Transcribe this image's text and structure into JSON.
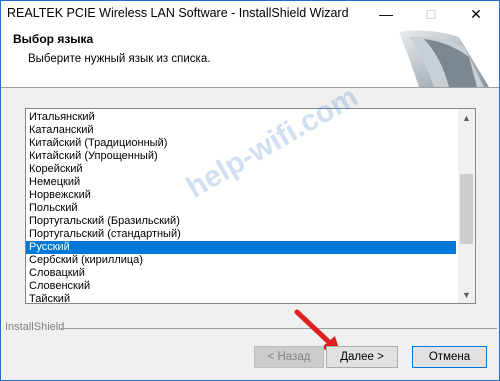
{
  "window": {
    "title": "REALTEK PCIE Wireless LAN Software - InstallShield Wizard"
  },
  "header": {
    "title": "Выбор языка",
    "subtitle": "Выберите нужный язык из списка."
  },
  "languages": [
    "Итальянский",
    "Каталанский",
    "Китайский (Традиционный)",
    "Китайский (Упрощенный)",
    "Корейский",
    "Немецкий",
    "Норвежский",
    "Польский",
    "Португальский (Бразильский)",
    "Португальский (стандартный)",
    "Русский",
    "Сербский (кириллица)",
    "Словацкий",
    "Словенский",
    "Тайский"
  ],
  "selected_language": "Русский",
  "footer": {
    "brand": "InstallShield",
    "back_label": "< Назад",
    "next_label": "Далее >",
    "cancel_label": "Отмена"
  },
  "watermark": "help-wifi.com",
  "colors": {
    "selection": "#0078d7",
    "window_border": "#1f6fd1",
    "arrow": "#e02020"
  }
}
